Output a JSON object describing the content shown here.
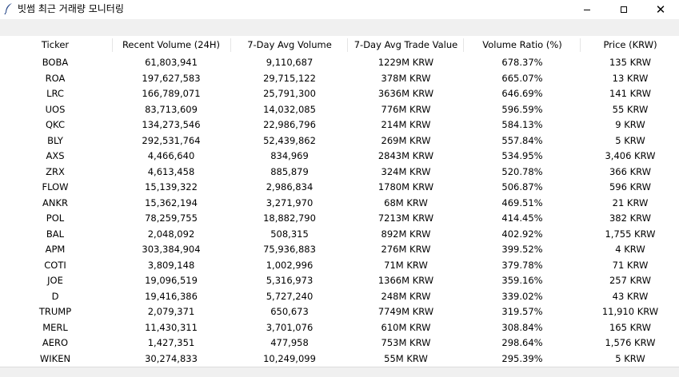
{
  "window": {
    "title": "빗썸 최근 거래량 모니터링"
  },
  "table": {
    "columns": [
      "Ticker",
      "Recent Volume (24H)",
      "7-Day Avg Volume",
      "7-Day Avg Trade Value",
      "Volume Ratio (%)",
      "Price (KRW)"
    ],
    "rows": [
      [
        "BOBA",
        "61,803,941",
        "9,110,687",
        "1229M KRW",
        "678.37%",
        "135 KRW"
      ],
      [
        "ROA",
        "197,627,583",
        "29,715,122",
        "378M KRW",
        "665.07%",
        "13 KRW"
      ],
      [
        "LRC",
        "166,789,071",
        "25,791,300",
        "3636M KRW",
        "646.69%",
        "141 KRW"
      ],
      [
        "UOS",
        "83,713,609",
        "14,032,085",
        "776M KRW",
        "596.59%",
        "55 KRW"
      ],
      [
        "QKC",
        "134,273,546",
        "22,986,796",
        "214M KRW",
        "584.13%",
        "9 KRW"
      ],
      [
        "BLY",
        "292,531,764",
        "52,439,862",
        "269M KRW",
        "557.84%",
        "5 KRW"
      ],
      [
        "AXS",
        "4,466,640",
        "834,969",
        "2843M KRW",
        "534.95%",
        "3,406 KRW"
      ],
      [
        "ZRX",
        "4,613,458",
        "885,879",
        "324M KRW",
        "520.78%",
        "366 KRW"
      ],
      [
        "FLOW",
        "15,139,322",
        "2,986,834",
        "1780M KRW",
        "506.87%",
        "596 KRW"
      ],
      [
        "ANKR",
        "15,362,194",
        "3,271,970",
        "68M KRW",
        "469.51%",
        "21 KRW"
      ],
      [
        "POL",
        "78,259,755",
        "18,882,790",
        "7213M KRW",
        "414.45%",
        "382 KRW"
      ],
      [
        "BAL",
        "2,048,092",
        "508,315",
        "892M KRW",
        "402.92%",
        "1,755 KRW"
      ],
      [
        "APM",
        "303,384,904",
        "75,936,883",
        "276M KRW",
        "399.52%",
        "4 KRW"
      ],
      [
        "COTI",
        "3,809,148",
        "1,002,996",
        "71M KRW",
        "379.78%",
        "71 KRW"
      ],
      [
        "JOE",
        "19,096,519",
        "5,316,973",
        "1366M KRW",
        "359.16%",
        "257 KRW"
      ],
      [
        "D",
        "19,416,386",
        "5,727,240",
        "248M KRW",
        "339.02%",
        "43 KRW"
      ],
      [
        "TRUMP",
        "2,079,371",
        "650,673",
        "7749M KRW",
        "319.57%",
        "11,910 KRW"
      ],
      [
        "MERL",
        "11,430,311",
        "3,701,076",
        "610M KRW",
        "308.84%",
        "165 KRW"
      ],
      [
        "AERO",
        "1,427,351",
        "477,958",
        "753M KRW",
        "298.64%",
        "1,576 KRW"
      ],
      [
        "WIKEN",
        "30,274,833",
        "10,249,099",
        "55M KRW",
        "295.39%",
        "5 KRW"
      ]
    ]
  }
}
